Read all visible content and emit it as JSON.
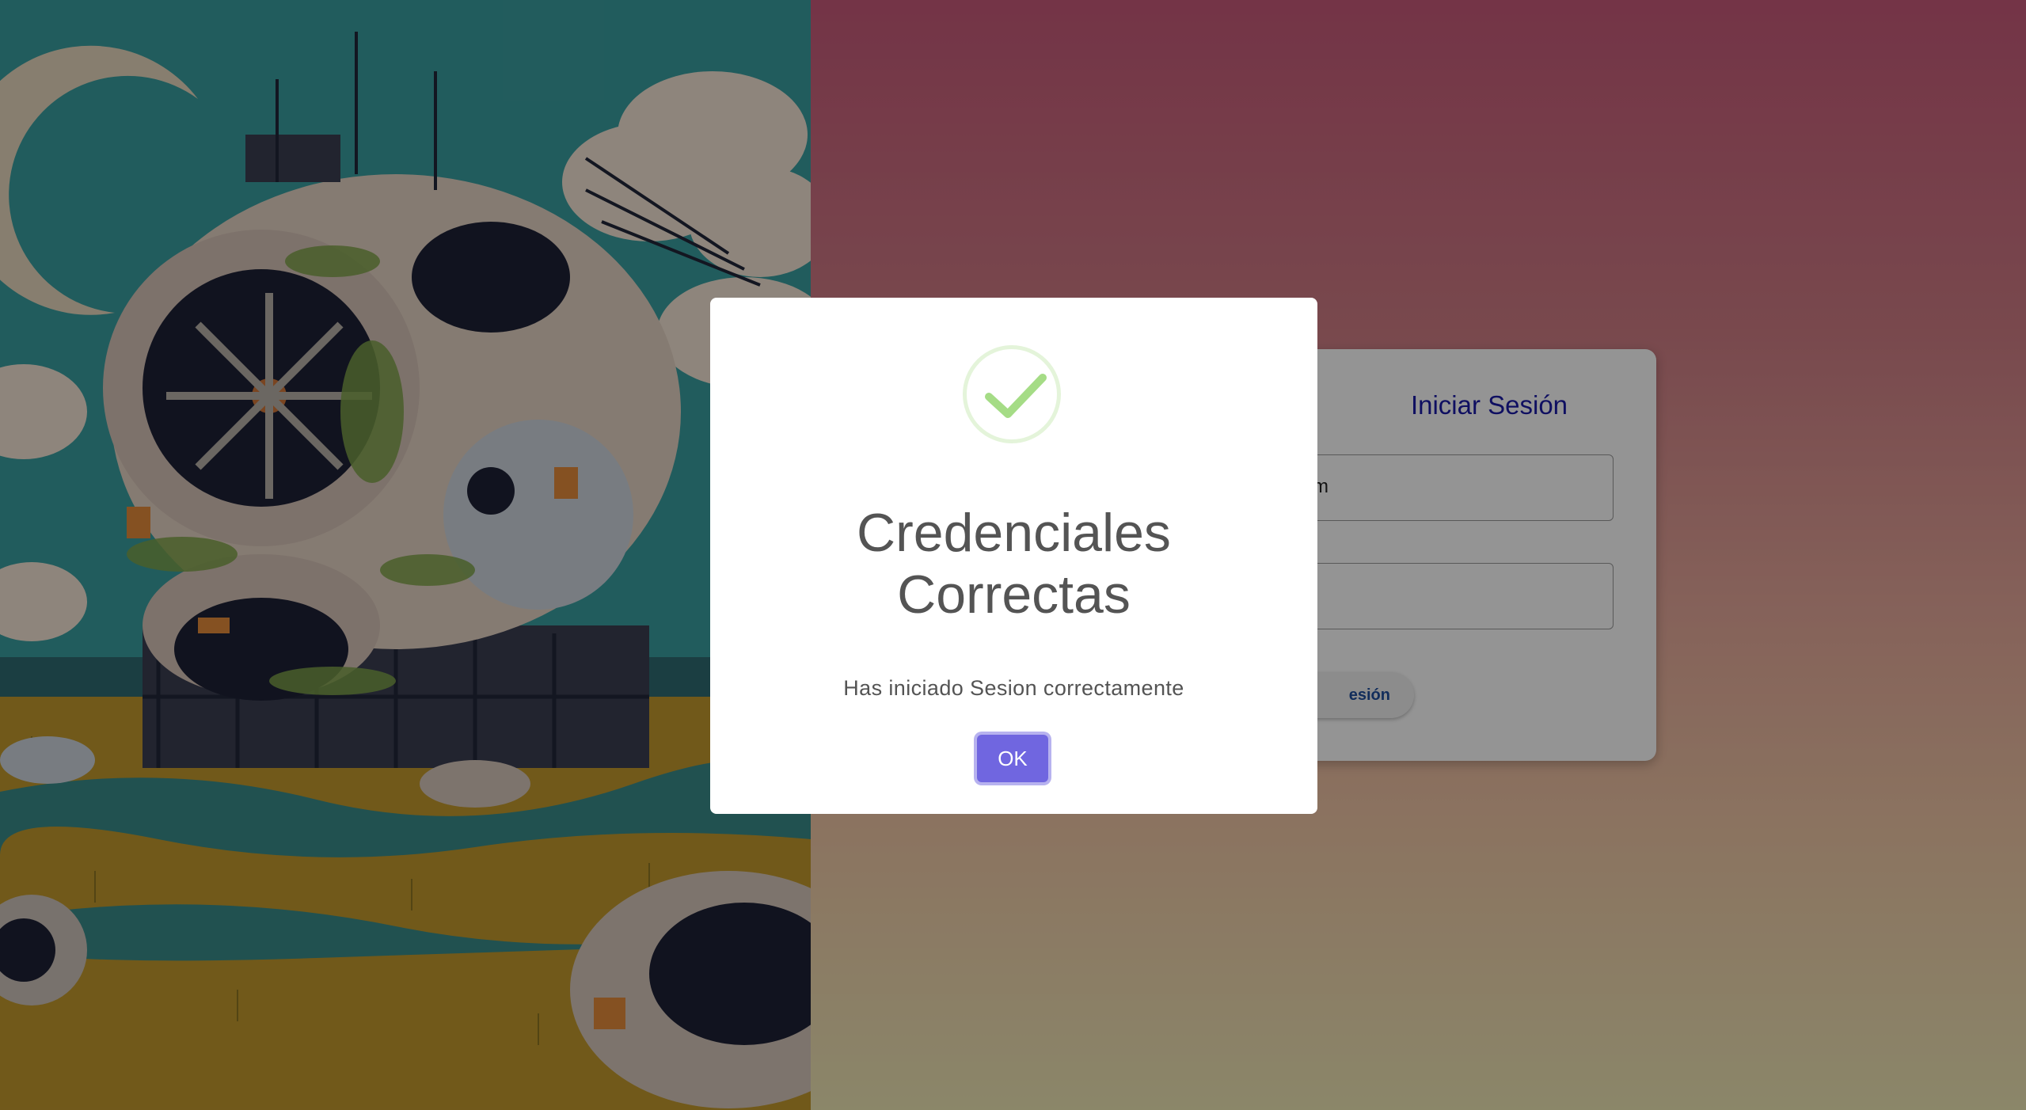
{
  "login": {
    "title": "Iniciar Sesión",
    "email_value": "ail.com",
    "password_label": "*",
    "button_label": "esión"
  },
  "modal": {
    "title": "Credenciales\nCorrectas",
    "text": "Has iniciado Sesion correctamente",
    "ok_label": "OK",
    "icon": "success-check-icon"
  },
  "colors": {
    "accent": "#7066e0",
    "success": "#a5dc86",
    "login_title": "#1a1aa8",
    "login_button_text": "#1f4f9e"
  }
}
